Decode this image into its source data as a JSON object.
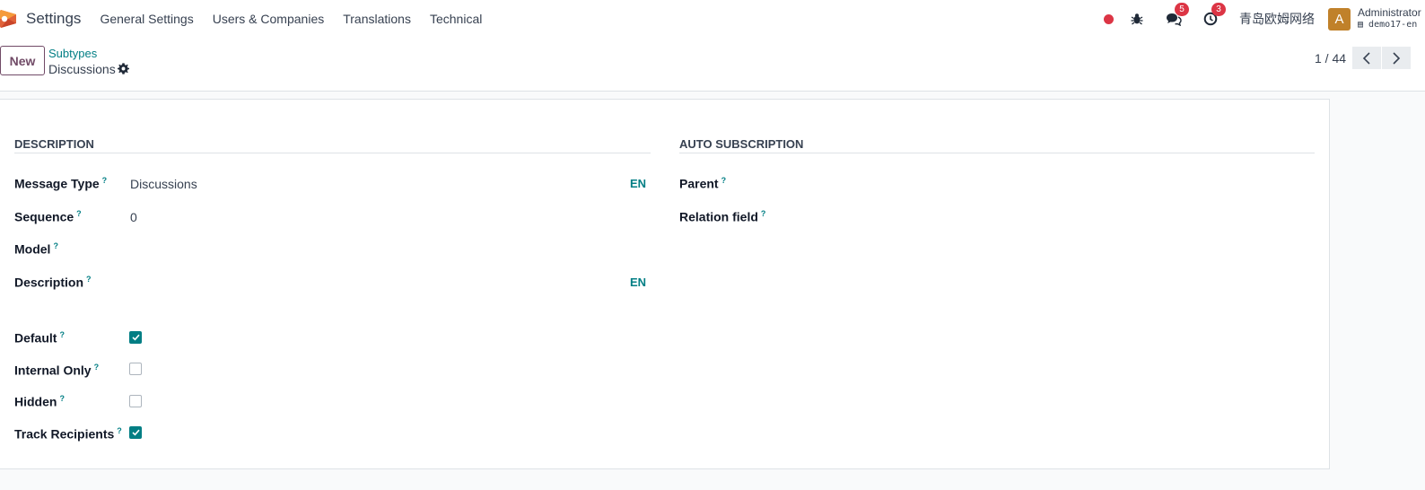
{
  "navbar": {
    "app_title": "Settings",
    "menus": [
      "General Settings",
      "Users & Companies",
      "Translations",
      "Technical"
    ],
    "messages_count": "5",
    "activities_count": "3",
    "company": "青岛欧姆网络",
    "avatar_letter": "A",
    "user_name": "Administrator",
    "database": "demo17-en"
  },
  "control": {
    "new_label": "New",
    "breadcrumb_parent": "Subtypes",
    "breadcrumb_current": "Discussions",
    "pager": "1 / 44"
  },
  "form": {
    "group_description": "DESCRIPTION",
    "group_auto_subscription": "AUTO SUBSCRIPTION",
    "message_type_label": "Message Type",
    "message_type_value": "Discussions",
    "sequence_label": "Sequence",
    "sequence_value": "0",
    "model_label": "Model",
    "description_label": "Description",
    "lang_code": "EN",
    "default_label": "Default",
    "default_checked": true,
    "internal_label": "Internal Only",
    "internal_checked": false,
    "hidden_label": "Hidden",
    "hidden_checked": false,
    "track_label": "Track Recipients",
    "track_checked": true,
    "parent_label": "Parent",
    "relation_label": "Relation field",
    "help_mark": "?"
  },
  "colors": {
    "primary": "#714b67",
    "accent": "#017e84",
    "danger": "#dc3545"
  }
}
